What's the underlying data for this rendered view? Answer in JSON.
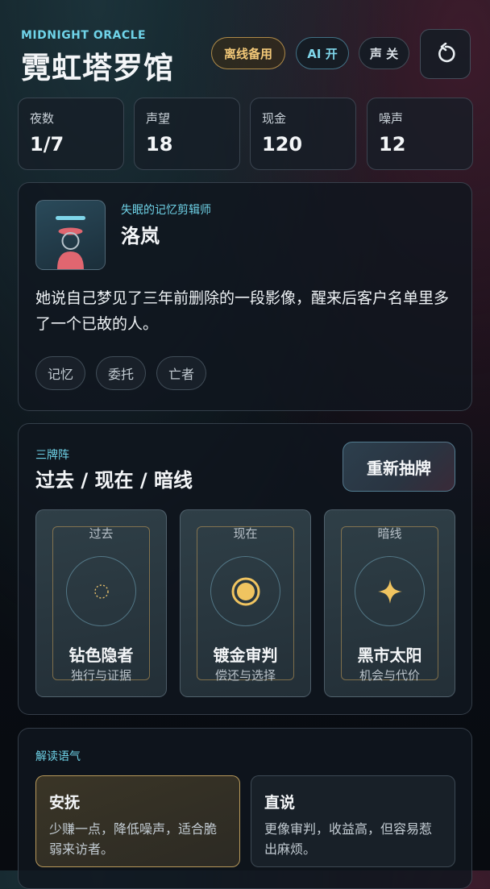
{
  "brand": {
    "subtitle": "MIDNIGHT ORACLE",
    "title": "霓虹塔罗馆"
  },
  "header": {
    "offline_label": "离线备用",
    "ai_label": "AI 开",
    "sound_label": "声 关",
    "reset_icon": "refresh-icon"
  },
  "stats": [
    {
      "label": "夜数",
      "value": "1/7"
    },
    {
      "label": "声望",
      "value": "18"
    },
    {
      "label": "现金",
      "value": "120"
    },
    {
      "label": "噪声",
      "value": "12"
    }
  ],
  "client": {
    "role": "失眠的记忆剪辑师",
    "name": "洛岚",
    "story": "她说自己梦见了三年前删除的一段影像，醒来后客户名单里多了一个已故的人。",
    "tags": [
      "记忆",
      "委托",
      "亡者"
    ]
  },
  "spread": {
    "kicker": "三牌阵",
    "title": "过去 / 现在 / 暗线",
    "redraw_label": "重新抽牌",
    "cards": [
      {
        "position": "过去",
        "name": "钻色隐者",
        "meaning": "独行与证据",
        "symbol": "dotted-ring-icon"
      },
      {
        "position": "现在",
        "name": "镀金审判",
        "meaning": "偿还与选择",
        "symbol": "gold-disc-icon"
      },
      {
        "position": "暗线",
        "name": "黑市太阳",
        "meaning": "机会与代价",
        "symbol": "star-icon"
      }
    ]
  },
  "tone": {
    "label": "解读语气",
    "options": [
      {
        "title": "安抚",
        "desc": "少赚一点，降低噪声，适合脆弱来访者。",
        "selected": true
      },
      {
        "title": "直说",
        "desc": "更像审判，收益高，但容易惹出麻烦。",
        "selected": false
      }
    ]
  },
  "colors": {
    "accent_cyan": "#6fd3e8",
    "accent_gold": "#f2c878"
  }
}
